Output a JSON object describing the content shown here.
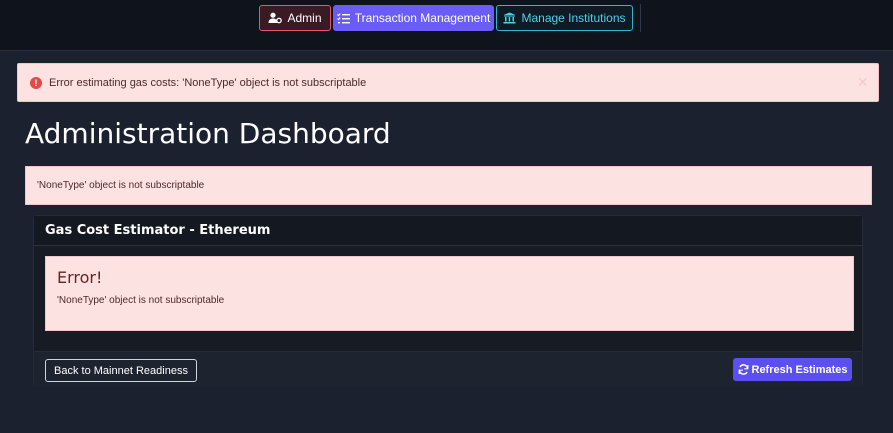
{
  "nav": {
    "admin_label": "Admin",
    "transactions_label": "Transaction Management",
    "institutions_label": "Manage Institutions"
  },
  "top_alert": {
    "message": "Error estimating gas costs: 'NoneType' object is not subscriptable",
    "close_symbol": "×"
  },
  "page_title": "Administration Dashboard",
  "main_alert": {
    "message": "'NoneType' object is not subscriptable"
  },
  "card": {
    "header": "Gas Cost Estimator - Ethereum",
    "error_title": "Error!",
    "error_message": "'NoneType' object is not subscriptable",
    "back_label": "Back to Mainnet Readiness",
    "refresh_label": "Refresh Estimates"
  },
  "colors": {
    "background": "#1c2130",
    "alert_bg": "#fde2e2",
    "admin_border": "#e0596b",
    "tx_bg": "#6a5cf5",
    "institutions_accent": "#4fd1e8",
    "refresh_bg": "#5b4ff0"
  },
  "icons": [
    "user-cog-icon",
    "list-check-icon",
    "bank-icon",
    "error-circle-icon",
    "close-icon",
    "refresh-icon"
  ]
}
